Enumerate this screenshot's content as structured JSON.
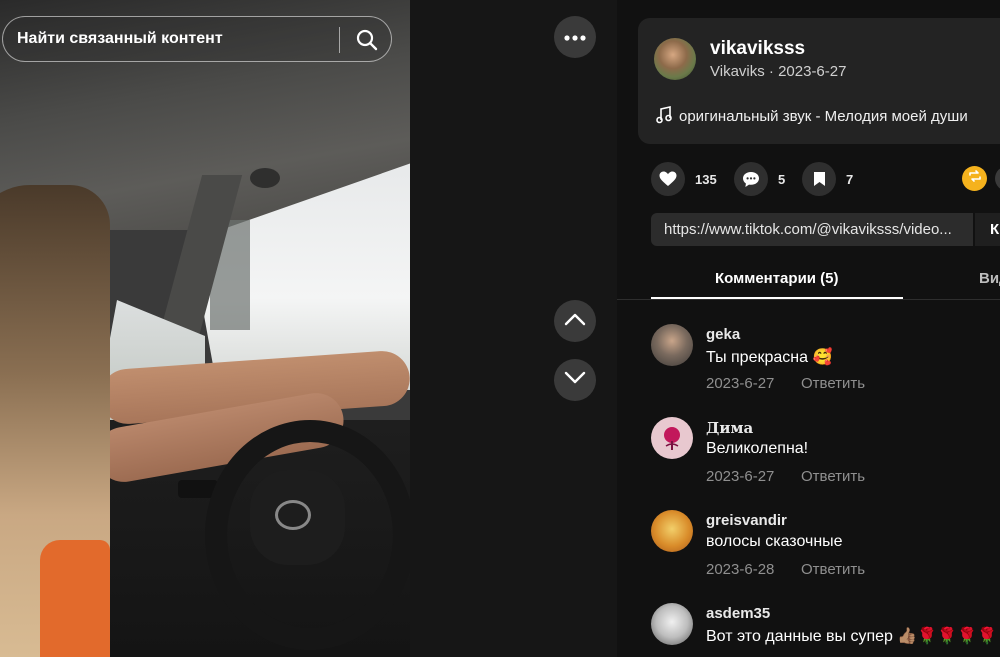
{
  "search": {
    "placeholder": "Найти связанный контент"
  },
  "post": {
    "author_handle": "vikaviksss",
    "meta": "Vikaviks · 2023-6-27",
    "music": "оригинальный звук - Мелодия моей души"
  },
  "actions": {
    "likes": "135",
    "comments": "5",
    "saves": "7"
  },
  "share": {
    "url": "https://www.tiktok.com/@vikaviksss/video...",
    "copy_label": "К"
  },
  "tabs": [
    {
      "label": "Комментарии (5)",
      "active": true
    },
    {
      "label": "Вид",
      "active": false
    }
  ],
  "comments": [
    {
      "user": "geka",
      "text": "Ты прекрасна 🥰",
      "date": "2023-6-27",
      "reply": "Ответить"
    },
    {
      "user": "Дима",
      "text": "Великолепна!",
      "date": "2023-6-27",
      "reply": "Ответить"
    },
    {
      "user": "greisvandir",
      "text": "волосы сказочные",
      "date": "2023-6-28",
      "reply": "Ответить"
    },
    {
      "user": "asdem35",
      "text": "Вот это данные вы супер 👍🏽🌹🌹🌹🌹🌹",
      "date": "",
      "reply": ""
    }
  ],
  "icons": {
    "search": "search-icon",
    "more": "more-dots-icon",
    "up": "chevron-up-icon",
    "down": "chevron-down-icon",
    "music": "music-note-icon",
    "like": "heart-icon",
    "comment": "comment-bubble-icon",
    "save": "bookmark-icon",
    "repost": "repost-icon"
  },
  "colors": {
    "background": "#121212",
    "card": "#232323",
    "repost": "#f5b21d",
    "muted_text": "#8f8f8f"
  }
}
